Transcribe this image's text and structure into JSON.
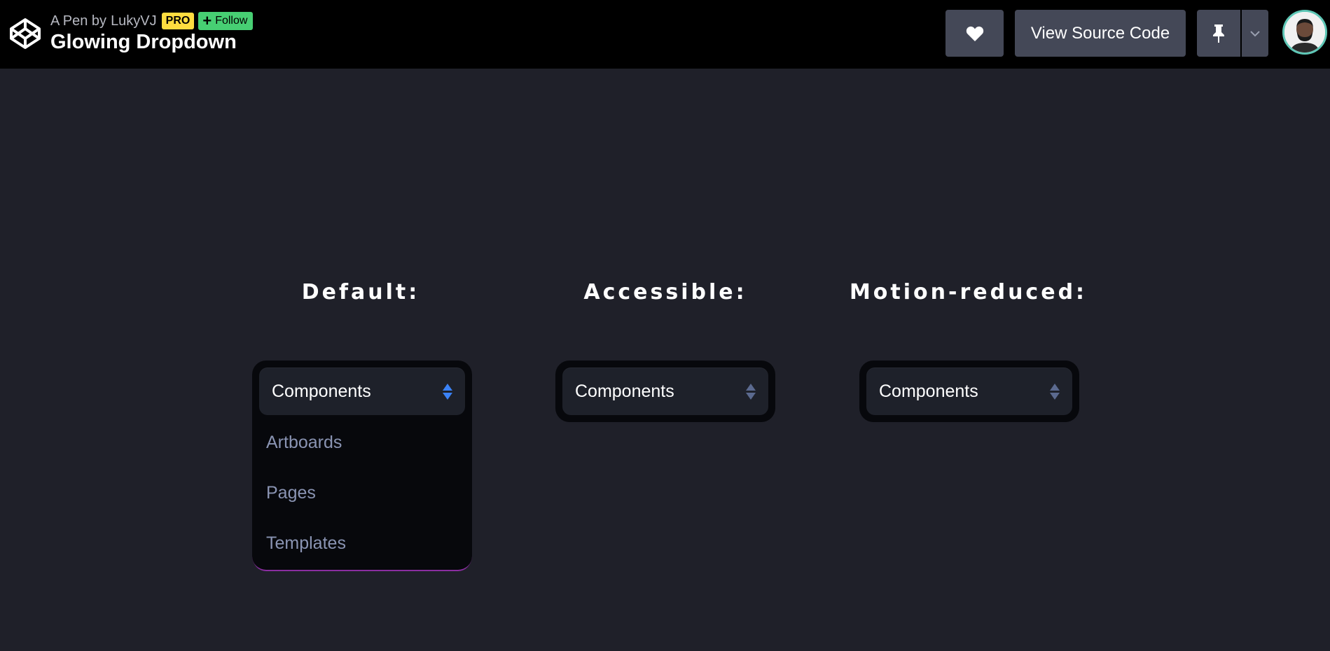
{
  "header": {
    "by_prefix": "A Pen by",
    "author": "LukyVJ",
    "pro_badge": "PRO",
    "follow_label": "Follow",
    "pen_title": "Glowing Dropdown",
    "view_source_label": "View Source Code",
    "icons": [
      "codepen-logo-icon",
      "heart-icon",
      "pin-icon",
      "chevron-down-icon",
      "avatar"
    ]
  },
  "columns": [
    {
      "label": "Default:",
      "dropdown": {
        "selected": "Components",
        "expanded": true,
        "options": [
          "Artboards",
          "Pages",
          "Templates"
        ],
        "arrow_color": "#3b82f6"
      }
    },
    {
      "label": "Accessible:",
      "dropdown": {
        "selected": "Components",
        "expanded": false,
        "arrow_color": "#5b6a8f"
      }
    },
    {
      "label": "Motion-reduced:",
      "dropdown": {
        "selected": "Components",
        "expanded": false,
        "arrow_color": "#5b6a8f"
      }
    }
  ],
  "colors": {
    "background": "#1f2029",
    "header_bg": "#000000",
    "button_bg": "#444857",
    "pro_badge": "#ffdd40",
    "follow": "#47cf73",
    "glow": "#8a2da0"
  }
}
